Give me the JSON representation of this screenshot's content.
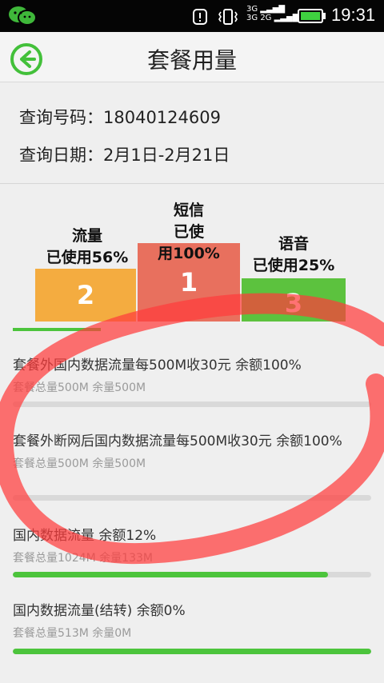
{
  "status": {
    "time": "19:31",
    "net_top": "3G",
    "net_bottom": "2G"
  },
  "header": {
    "title": "套餐用量"
  },
  "query": {
    "number_label": "查询号码：",
    "number": "18040124609",
    "date_label": "查询日期：",
    "date_range": "2月1日-2月21日"
  },
  "chart_data": {
    "type": "bar",
    "bars": [
      {
        "rank": "2",
        "label_line1": "流量",
        "label_line2": "已使用56%",
        "color": "#f4ac40"
      },
      {
        "rank": "1",
        "label_line1": "短信",
        "label_line2": "已使",
        "label_line3": "用100%",
        "color": "#e8705e"
      },
      {
        "rank": "3",
        "label_line1": "语音",
        "label_line2": "已使用25%",
        "color": "#5cc23e"
      }
    ]
  },
  "items": [
    {
      "title": "套餐外国内数据流量每500M收30元 余额100%",
      "sub": "套餐总量500M 余量500M",
      "progress": 0
    },
    {
      "title": "套餐外断网后国内数据流量每500M收30元 余额100%",
      "sub": "套餐总量500M 余量500M",
      "progress": 0
    },
    {
      "title": "国内数据流量 余额12%",
      "sub": "套餐总量1024M 余量133M",
      "progress": 0.88
    },
    {
      "title": "国内数据流量(结转) 余额0%",
      "sub": "套餐总量513M 余量0M",
      "progress": 1.0
    }
  ]
}
